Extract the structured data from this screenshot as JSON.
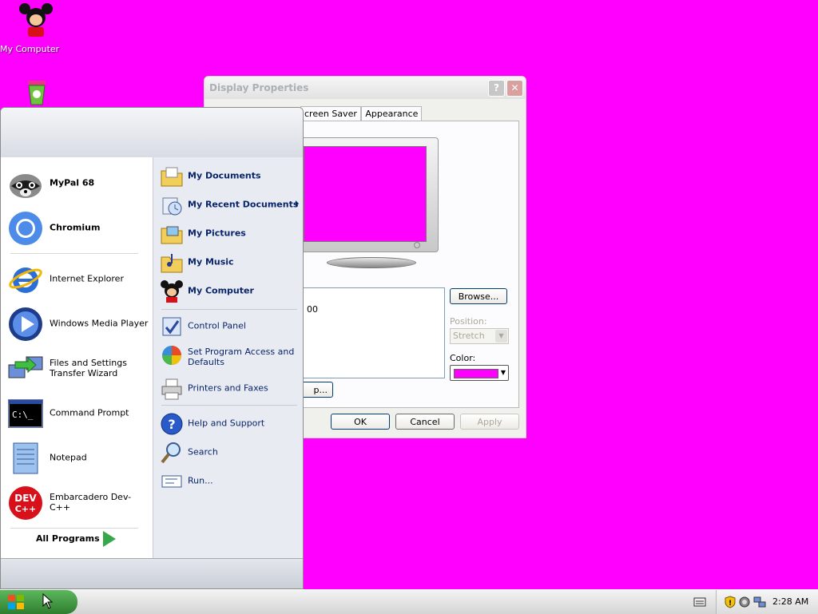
{
  "desktop": {
    "icons": [
      {
        "name": "mickey-icon",
        "label": "My Computer"
      },
      {
        "name": "recycle-bin-icon",
        "label": ""
      }
    ]
  },
  "display_window": {
    "title": "Display Properties",
    "tabs": [
      "creen Saver",
      "Appearance"
    ],
    "listbox_value": "00",
    "browse_label": "Browse...",
    "position_label": "Position:",
    "position_value": "Stretch",
    "color_label": "Color:",
    "color_value": "#ff00ff",
    "customize_label": "p...",
    "ok_label": "OK",
    "cancel_label": "Cancel",
    "apply_label": "Apply"
  },
  "start_menu": {
    "pinned": [
      {
        "name": "mypal-icon",
        "label": "MyPal 68"
      },
      {
        "name": "chromium-icon",
        "label": "Chromium"
      }
    ],
    "recent": [
      {
        "name": "internet-explorer-icon",
        "label": "Internet Explorer"
      },
      {
        "name": "media-player-icon",
        "label": "Windows Media Player"
      },
      {
        "name": "transfer-wizard-icon",
        "label": "Files and Settings Transfer Wizard"
      },
      {
        "name": "command-prompt-icon",
        "label": "Command Prompt"
      },
      {
        "name": "notepad-icon",
        "label": "Notepad"
      },
      {
        "name": "devcpp-icon",
        "label": "Embarcadero Dev-C++"
      }
    ],
    "all_programs_label": "All Programs",
    "right": [
      {
        "name": "my-documents-icon",
        "label": "My Documents"
      },
      {
        "name": "recent-documents-icon",
        "label": "My Recent Documents"
      },
      {
        "name": "my-pictures-icon",
        "label": "My Pictures"
      },
      {
        "name": "my-music-icon",
        "label": "My Music"
      },
      {
        "name": "my-computer-icon",
        "label": "My Computer"
      },
      {
        "name": "control-panel-icon",
        "label": "Control Panel"
      },
      {
        "name": "program-access-icon",
        "label": "Set Program Access and Defaults"
      },
      {
        "name": "printers-icon",
        "label": "Printers and Faxes"
      },
      {
        "name": "help-icon",
        "label": "Help and Support"
      },
      {
        "name": "search-icon",
        "label": "Search"
      },
      {
        "name": "run-icon",
        "label": "Run..."
      }
    ]
  },
  "taskbar": {
    "clock": "2:28 AM"
  }
}
